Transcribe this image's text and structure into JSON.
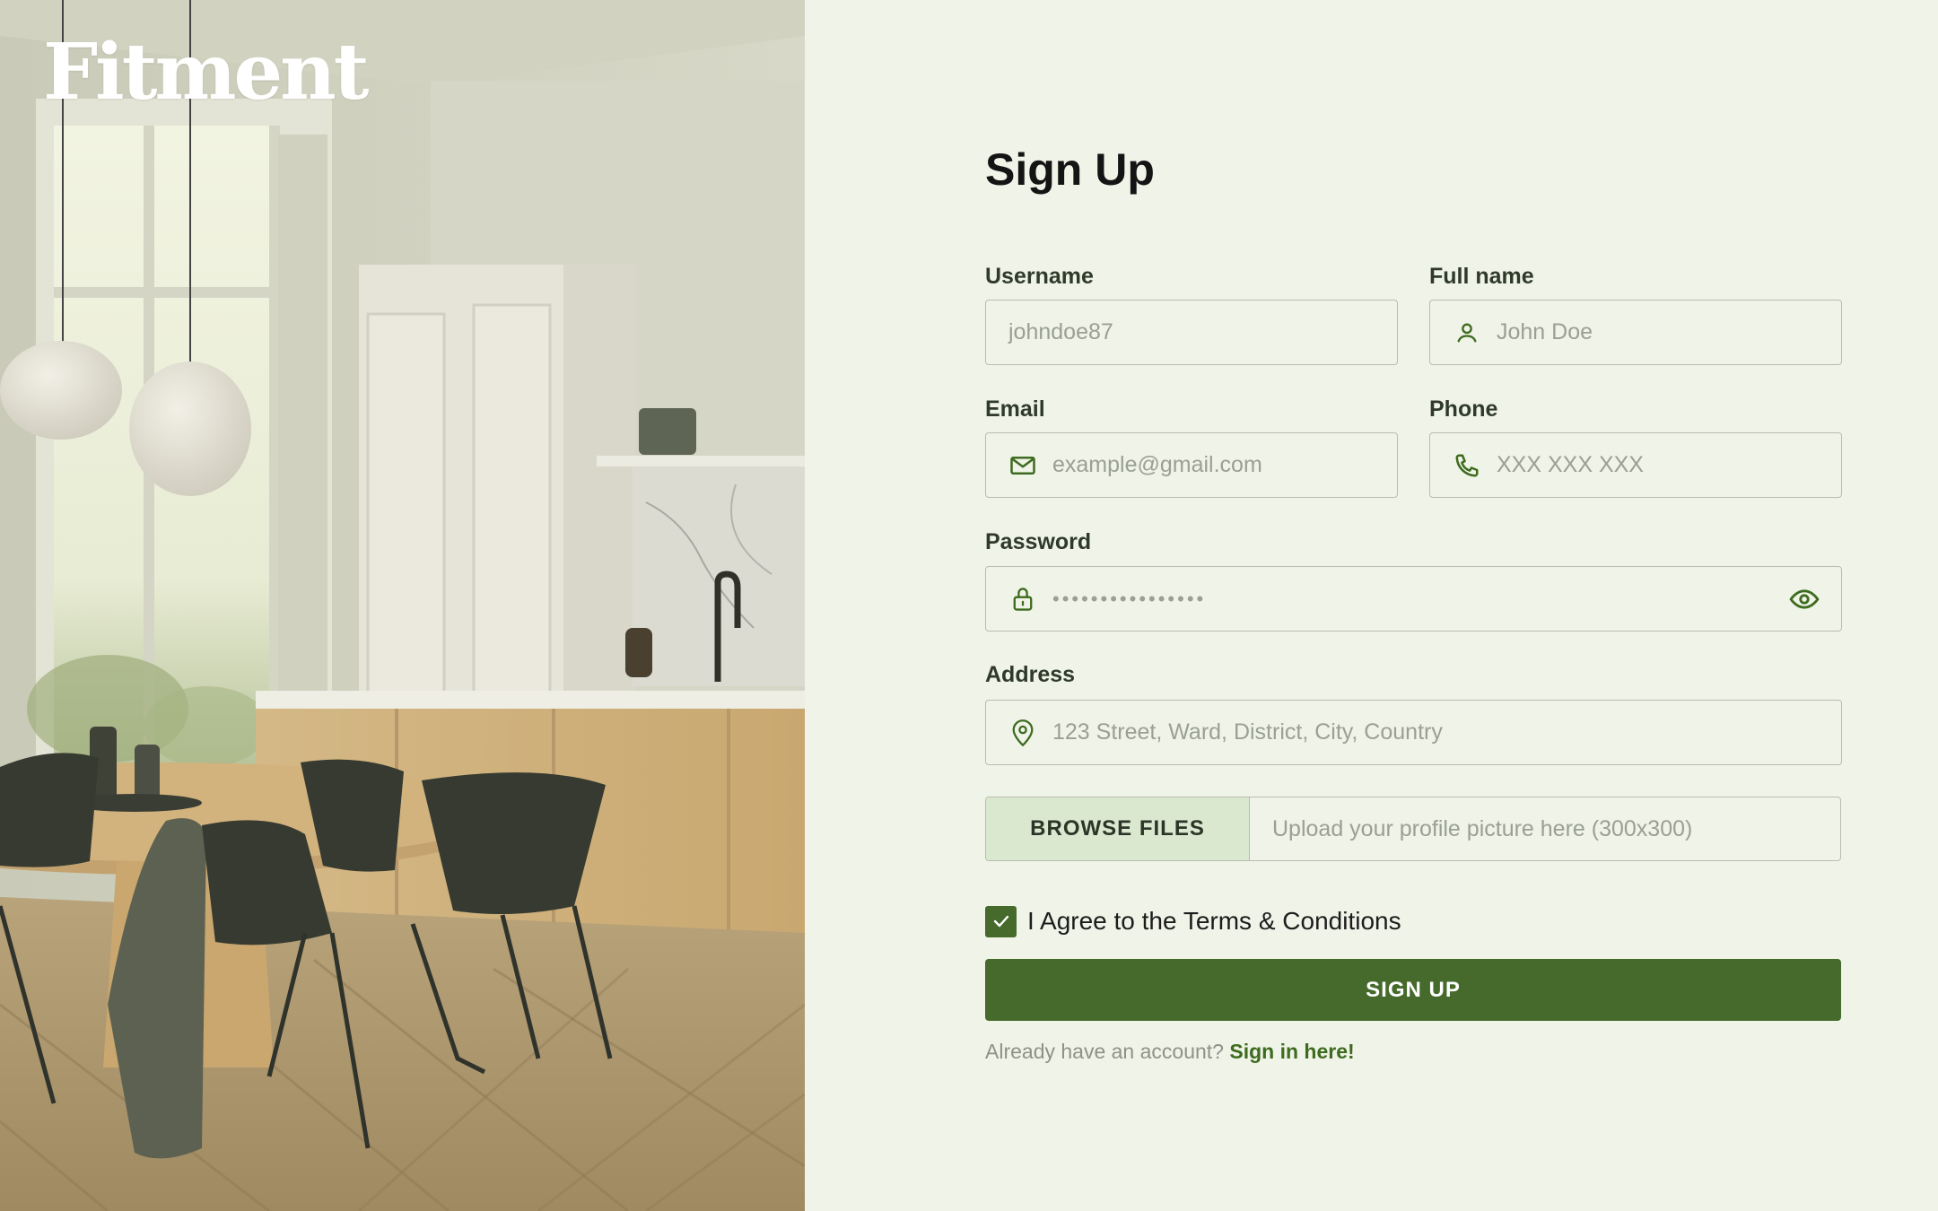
{
  "brand": {
    "name": "Fitment"
  },
  "page": {
    "title": "Sign Up"
  },
  "fields": {
    "username": {
      "label": "Username",
      "placeholder": "johndoe87",
      "icon": "none"
    },
    "fullname": {
      "label": "Full name",
      "placeholder": "John Doe",
      "icon": "user-icon"
    },
    "email": {
      "label": "Email",
      "placeholder": "example@gmail.com",
      "icon": "mail-icon"
    },
    "phone": {
      "label": "Phone",
      "placeholder": "XXX XXX XXX",
      "icon": "phone-icon"
    },
    "password": {
      "label": "Password",
      "masked_value": "••••••••••••••••",
      "icon": "lock-icon",
      "toggle_icon": "eye-icon"
    },
    "address": {
      "label": "Address",
      "placeholder": "123 Street, Ward, District, City, Country",
      "icon": "map-pin-icon"
    }
  },
  "upload": {
    "button_label": "BROWSE FILES",
    "placeholder": "Upload your profile picture here (300x300)"
  },
  "terms": {
    "label": "I Agree to the Terms & Conditions",
    "checked": true
  },
  "submit": {
    "label": "SIGN UP"
  },
  "signin": {
    "prompt": "Already have an account?",
    "link_label": "Sign in here!"
  },
  "colors": {
    "accent": "#456a2c",
    "background": "#f0f3e7",
    "browse_bg": "#dbe8d0",
    "border": "#b9bdb0",
    "placeholder": "#9aa093"
  }
}
